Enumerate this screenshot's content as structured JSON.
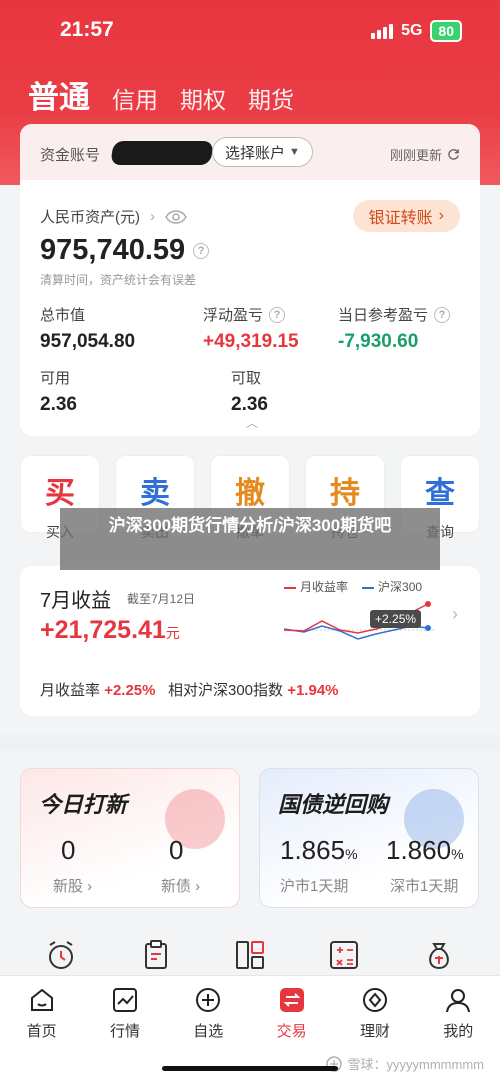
{
  "status": {
    "time": "21:57",
    "network": "5G",
    "battery": "80"
  },
  "tabs": [
    {
      "label": "普通"
    },
    {
      "label": "信用"
    },
    {
      "label": "期权"
    },
    {
      "label": "期货"
    }
  ],
  "account": {
    "label": "资金账号",
    "switch_label": "选择账户",
    "refresh": "刚刚更新",
    "asset_title": "人民币资产(元)",
    "asset_value": "975,740.59",
    "asset_note": "清算时间，资产统计会有误差",
    "bank_transfer": "银证转账",
    "metrics": [
      {
        "label": "总市值",
        "value": "957,054.80"
      },
      {
        "label": "浮动盈亏",
        "value": "+49,319.15"
      },
      {
        "label": "当日参考盈亏",
        "value": "-7,930.60"
      },
      {
        "label": "可用",
        "value": "2.36"
      },
      {
        "label": "可取",
        "value": "2.36"
      }
    ]
  },
  "actions": [
    {
      "glyph": "买",
      "label": "买入",
      "color": "#e8363f"
    },
    {
      "glyph": "卖",
      "label": "卖出",
      "color": "#2f6fd6"
    },
    {
      "glyph": "撤",
      "label": "撤单",
      "color": "#e48a1e"
    },
    {
      "glyph": "持",
      "label": "持仓",
      "color": "#e48a1e"
    },
    {
      "glyph": "查",
      "label": "查询",
      "color": "#2f6fd6"
    }
  ],
  "overlay_title": "沪深300期货行情分析/沪深300期货吧",
  "income": {
    "title": "7月收益",
    "date": "截至7月12日",
    "value": "+21,725.41",
    "unit": "元",
    "legend_month": "月收益率",
    "legend_index": "沪深300",
    "tooltip": "+2.25%",
    "footer_label1": "月收益率",
    "footer_value1": "+2.25%",
    "footer_label2": "相对沪深300指数",
    "footer_value2": "+1.94%"
  },
  "promos": {
    "left": {
      "title": "今日打新",
      "items": [
        {
          "num": "0",
          "label": "新股"
        },
        {
          "num": "0",
          "label": "新债"
        }
      ]
    },
    "right": {
      "title": "国债逆回购",
      "items": [
        {
          "num": "1.865",
          "unit": "%",
          "label": "沪市1天期"
        },
        {
          "num": "1.860",
          "unit": "%",
          "label": "深市1天期"
        }
      ]
    }
  },
  "nav": [
    {
      "label": "首页",
      "icon": "home-icon"
    },
    {
      "label": "行情",
      "icon": "chart-icon"
    },
    {
      "label": "自选",
      "icon": "plus-circle-icon"
    },
    {
      "label": "交易",
      "icon": "trade-icon"
    },
    {
      "label": "理财",
      "icon": "wealth-icon"
    },
    {
      "label": "我的",
      "icon": "user-icon"
    }
  ],
  "watermark": "雪球：yyyyymmmmmm",
  "colors": {
    "brand_red": "#e8363f",
    "gain": "#e8363f",
    "loss": "#17a06a",
    "index_blue": "#2f6fd6"
  }
}
